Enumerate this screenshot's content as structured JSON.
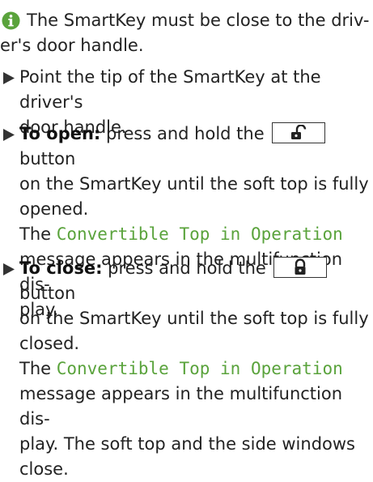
{
  "note": {
    "text_line1": "The SmartKey must be close to the driv-",
    "text_line2": "er's door handle."
  },
  "steps": [
    {
      "lines": [
        "Point the tip of the SmartKey at the driver's",
        "door handle."
      ]
    },
    {
      "label": "To open:",
      "pre_button": " press and hold the ",
      "post_button": " button",
      "line2": "on the SmartKey until the soft top is fully",
      "line3": "opened.",
      "msg_pre": "The ",
      "msg_code": "Convertible Top in Operation",
      "msg_line2": "message appears in the multifunction dis-",
      "msg_line3": "play."
    },
    {
      "label": "To close:",
      "pre_button": " press and hold the ",
      "post_button": " button",
      "line2": "on the SmartKey until the soft top is fully",
      "line3": "closed.",
      "msg_pre": "The ",
      "msg_code": "Convertible Top in Operation",
      "msg_line2": "message appears in the multifunction dis-",
      "msg_line3": "play. The soft top and the side windows",
      "msg_line4": "close."
    }
  ],
  "colors": {
    "info_icon": "#5aa33c",
    "display_message": "#5aa33c",
    "text": "#222222"
  },
  "icons": {
    "note": "info-icon",
    "step": "arrow-right-icon",
    "open_button": "unlock-icon",
    "close_button": "lock-icon"
  }
}
